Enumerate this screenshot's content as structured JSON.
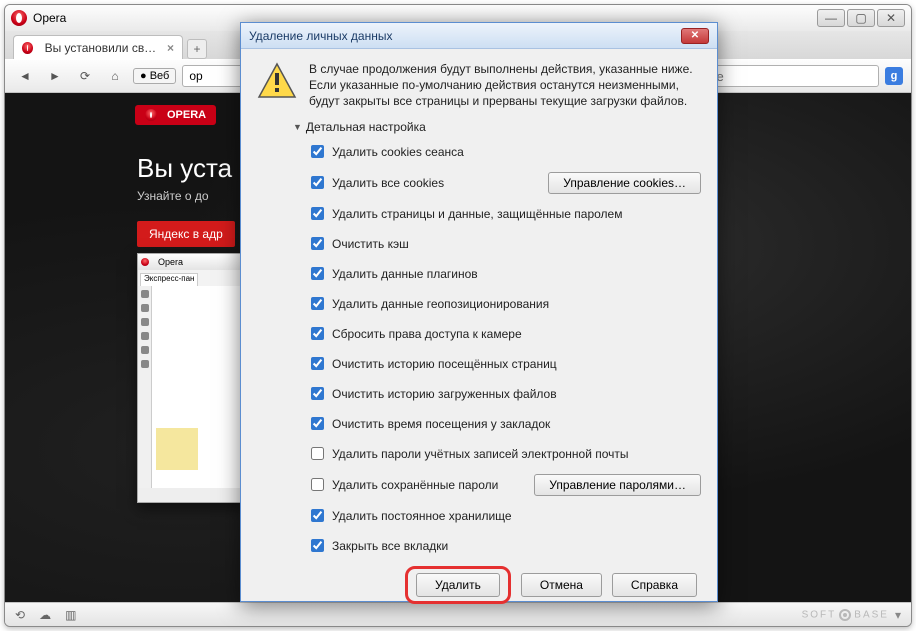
{
  "browser": {
    "title": "Opera",
    "tab_title": "Вы установили свежу…",
    "address_badge": "Веб",
    "address_prefix": "op",
    "search_placeholder": "gle"
  },
  "page": {
    "logo_text": "OPERA",
    "headline": "Вы уста",
    "subhead": "Узнайте о до",
    "yandex_button": "Яндекс в адр"
  },
  "mini": {
    "title": "Opera",
    "tab": "Экспресс-пан"
  },
  "dialog": {
    "title": "Удаление личных данных",
    "warning": "В случае продолжения будут выполнены действия, указанные ниже. Если указанные по-умолчанию действия останутся неизменными, будут закрыты все страницы и прерваны текущие загрузки файлов.",
    "detail_header": "Детальная настройка",
    "options": [
      {
        "label": "Удалить cookies сеанса",
        "checked": true
      },
      {
        "label": "Удалить все cookies",
        "checked": true,
        "button": "Управление cookies…"
      },
      {
        "label": "Удалить страницы и данные, защищённые паролем",
        "checked": true
      },
      {
        "label": "Очистить кэш",
        "checked": true
      },
      {
        "label": "Удалить данные плагинов",
        "checked": true
      },
      {
        "label": "Удалить данные геопозиционирования",
        "checked": true
      },
      {
        "label": "Сбросить права доступа к камере",
        "checked": true
      },
      {
        "label": "Очистить историю посещённых страниц",
        "checked": true
      },
      {
        "label": "Очистить историю загруженных файлов",
        "checked": true
      },
      {
        "label": "Очистить время посещения у закладок",
        "checked": true
      },
      {
        "label": "Удалить пароли учётных записей электронной почты",
        "checked": false
      },
      {
        "label": "Удалить сохранённые пароли",
        "checked": false,
        "button": "Управление паролями…"
      },
      {
        "label": "Удалить постоянное хранилище",
        "checked": true
      },
      {
        "label": "Закрыть все вкладки",
        "checked": true
      }
    ],
    "buttons": {
      "delete": "Удалить",
      "cancel": "Отмена",
      "help": "Справка"
    }
  },
  "statusbar": {
    "watermark_left": "SOFT",
    "watermark_right": "BASE"
  }
}
